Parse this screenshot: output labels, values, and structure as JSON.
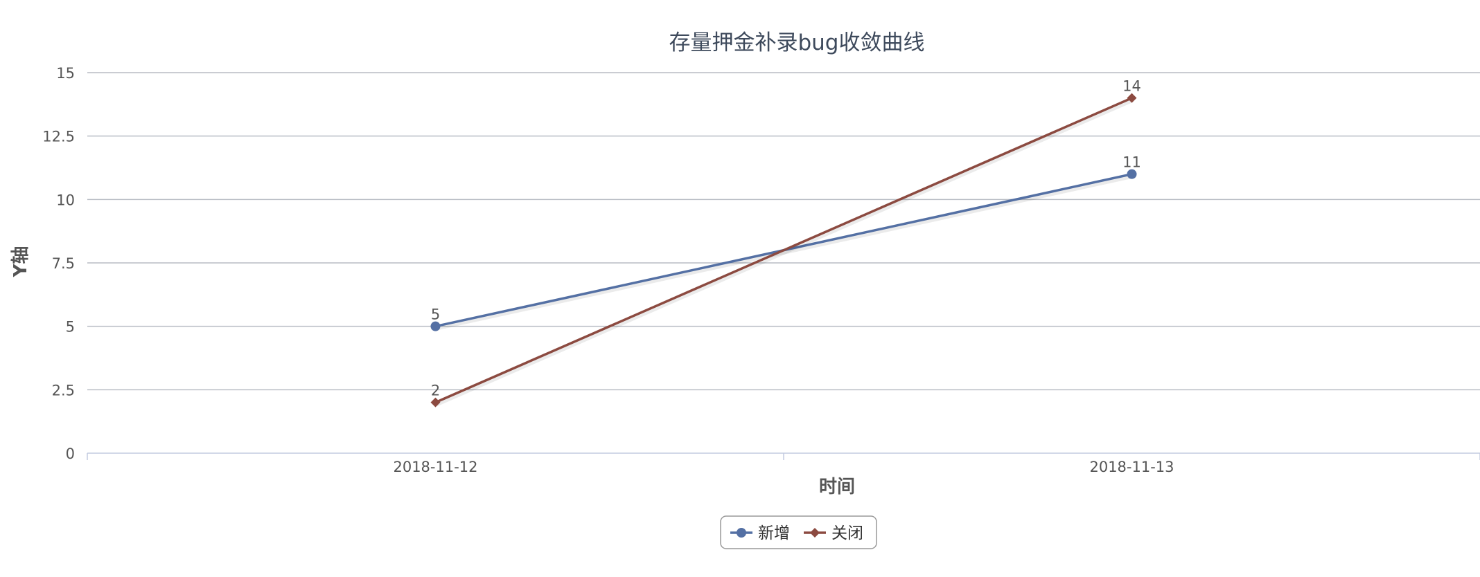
{
  "chart_data": {
    "type": "line",
    "title": "存量押金补录bug收敛曲线",
    "xlabel": "时间",
    "ylabel": "Y轴",
    "categories": [
      "2018-11-12",
      "2018-11-13"
    ],
    "ylim": [
      0,
      15
    ],
    "yticks": [
      "0",
      "2.5",
      "5",
      "7.5",
      "10",
      "12.5",
      "15"
    ],
    "grid": true,
    "legend_position": "bottom-center",
    "series": [
      {
        "name": "新增",
        "values": [
          5,
          11
        ],
        "color": "#5470a4",
        "marker": "circle"
      },
      {
        "name": "关闭",
        "values": [
          2,
          14
        ],
        "color": "#8c4a40",
        "marker": "diamond"
      }
    ]
  }
}
